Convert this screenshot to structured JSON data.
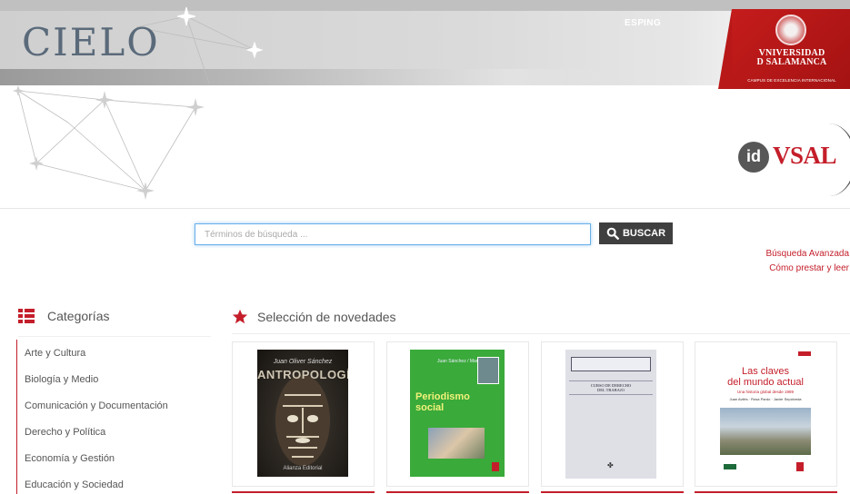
{
  "header": {
    "logo_text": "CIELO",
    "languages": [
      "ESP",
      "ING"
    ],
    "university": {
      "name_line1": "VNIVERSIDAD",
      "name_line2": "D SALAMANCA",
      "subtitle": "CAMPUS DE EXCELENCIA INTERNACIONAL"
    },
    "idvsal": {
      "badge": "id",
      "text": "VSAL"
    }
  },
  "search": {
    "placeholder": "Términos de búsqueda ...",
    "value": "",
    "button_label": "BUSCAR",
    "advanced_link": "Búsqueda Avanzada",
    "lend_link": "Cómo prestar y leer"
  },
  "categories": {
    "title": "Categorías",
    "items": [
      "Arte y Cultura",
      "Biología y Medio",
      "Comunicación y Documentación",
      "Derecho y Política",
      "Economía y Gestión",
      "Educación y Sociedad"
    ]
  },
  "new_selection": {
    "title": "Selección de novedades",
    "books": [
      {
        "author": "Juan Oliver Sánchez",
        "title": "ANTROPOLOGÍA",
        "publisher": "Alianza Editorial"
      },
      {
        "authors": "Juan Sánchez / Marta Lorenzo",
        "title_l1": "Periodismo",
        "title_l2": "social"
      },
      {
        "title_l1": "CURSO DE DERECHO",
        "title_l2": "DEL TRABAJO"
      },
      {
        "title_l1": "Las claves",
        "title_l2": "del mundo actual",
        "subtitle": "Una historia global desde 1989",
        "authors": "Juan Avilés · Rosa Pardo · Javier Sepúlveda"
      }
    ]
  },
  "colors": {
    "accent": "#c41e2a",
    "button": "#3f3f3f",
    "focus": "#66afe9"
  }
}
